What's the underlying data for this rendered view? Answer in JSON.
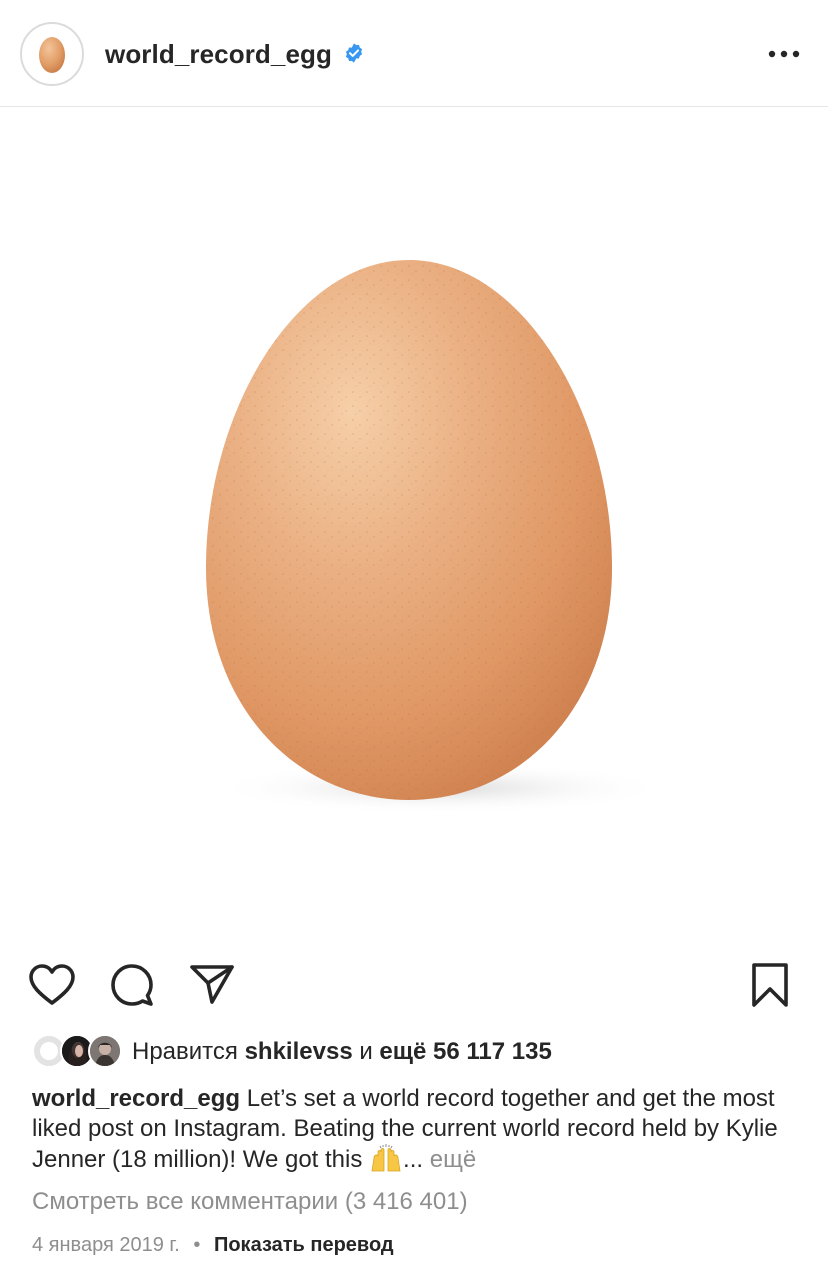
{
  "post": {
    "username": "world_record_egg",
    "verified": true,
    "avatar_icon": "egg-avatar-icon",
    "more_icon": "ellipsis-icon"
  },
  "image": {
    "subject_icon": "brown-egg-photo",
    "background_color": "#ffffff",
    "egg_color": "#e6a070"
  },
  "actions": {
    "like_icon": "heart-icon",
    "comment_icon": "comment-icon",
    "share_icon": "paper-plane-icon",
    "save_icon": "bookmark-icon"
  },
  "likes": {
    "prefix": "Нравится",
    "user": "shkilevss",
    "conj": "и",
    "others": "ещё 56 117 135"
  },
  "caption": {
    "username": "world_record_egg",
    "text": "Let’s set a world record together and get the most liked post on Instagram. Beating the current world record held by Kylie Jenner (18 million)! We got this",
    "emoji": "raising-hands-emoji",
    "ellipsis": "...",
    "more": "ещё"
  },
  "comments": {
    "view_all": "Смотреть все комментарии (3 416 401)"
  },
  "meta": {
    "date": "4 января 2019 г.",
    "separator": "•",
    "translate": "Показать перевод"
  }
}
